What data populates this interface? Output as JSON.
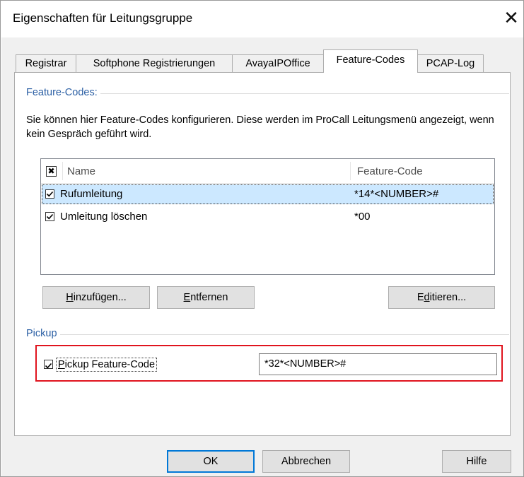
{
  "window": {
    "title": "Eigenschaften für Leitungsgruppe",
    "close_glyph": "✕"
  },
  "tabs": [
    {
      "label": "Registrar"
    },
    {
      "label": "Softphone Registrierungen"
    },
    {
      "label": "AvayaIPOffice"
    },
    {
      "label": "Feature-Codes",
      "active": true
    },
    {
      "label": "PCAP-Log"
    }
  ],
  "feature_codes_group": {
    "label": "Feature-Codes:",
    "description": "Sie können hier Feature-Codes konfigurieren. Diese werden im ProCall Leitungsmenü angezeigt, wenn kein Gespräch geführt wird.",
    "columns": {
      "check": "✖",
      "name": "Name",
      "code": "Feature-Code"
    },
    "rows": [
      {
        "checked": true,
        "name": "Rufumleitung",
        "code": "*14*<NUMBER>#",
        "selected": true
      },
      {
        "checked": true,
        "name": "Umleitung löschen",
        "code": "*00",
        "selected": false
      }
    ],
    "buttons": {
      "add": {
        "accel": "H",
        "rest": "inzufügen..."
      },
      "remove": {
        "accel": "E",
        "rest": "ntfernen"
      },
      "edit": {
        "pre": "E",
        "accel": "d",
        "rest": "itieren..."
      }
    }
  },
  "pickup_group": {
    "label": "Pickup",
    "checkbox": {
      "checked": true,
      "accel": "P",
      "rest": "ickup Feature-Code"
    },
    "value": "*32*<NUMBER>#"
  },
  "footer": {
    "ok": "OK",
    "cancel": "Abbrechen",
    "help": "Hilfe"
  },
  "colors": {
    "highlight": "#e0141e",
    "group_label": "#2b5fa4",
    "selection": "#cce8ff",
    "default_button": "#0078d7"
  }
}
